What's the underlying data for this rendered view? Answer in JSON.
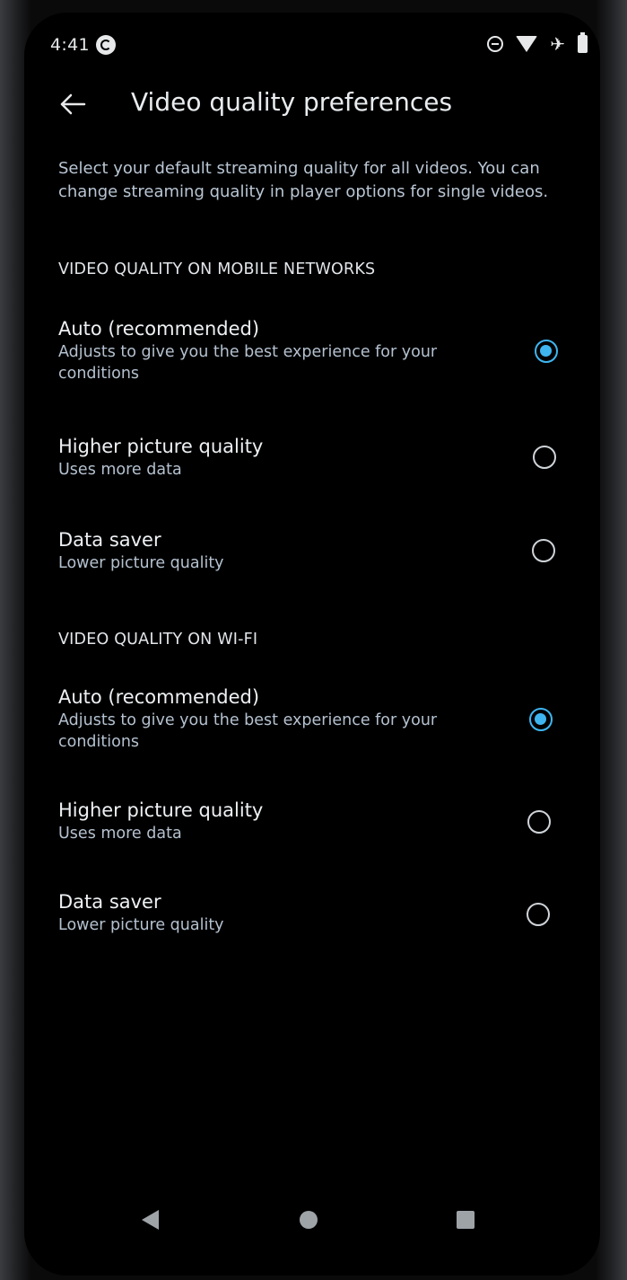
{
  "status_bar": {
    "time": "4:41"
  },
  "app_bar": {
    "title": "Video quality preferences",
    "back_icon": "arrow-back-icon"
  },
  "description": "Select your default streaming quality for all videos. You can change streaming quality in player options for single videos.",
  "sections": [
    {
      "header": "VIDEO QUALITY ON MOBILE NETWORKS",
      "options": [
        {
          "title": "Auto (recommended)",
          "subtitle": "Adjusts to give you the best experience for your conditions",
          "selected": true
        },
        {
          "title": "Higher picture quality",
          "subtitle": "Uses more data",
          "selected": false
        },
        {
          "title": "Data saver",
          "subtitle": "Lower picture quality",
          "selected": false
        }
      ]
    },
    {
      "header": "VIDEO QUALITY ON WI-FI",
      "options": [
        {
          "title": "Auto (recommended)",
          "subtitle": "Adjusts to give you the best experience for your conditions",
          "selected": true
        },
        {
          "title": "Higher picture quality",
          "subtitle": "Uses more data",
          "selected": false
        },
        {
          "title": "Data saver",
          "subtitle": "Lower picture quality",
          "selected": false
        }
      ]
    }
  ],
  "colors": {
    "accent": "#3fb5f0",
    "background": "#000000",
    "primary_text": "#eef1f4",
    "secondary_text": "#b4c1cf"
  }
}
